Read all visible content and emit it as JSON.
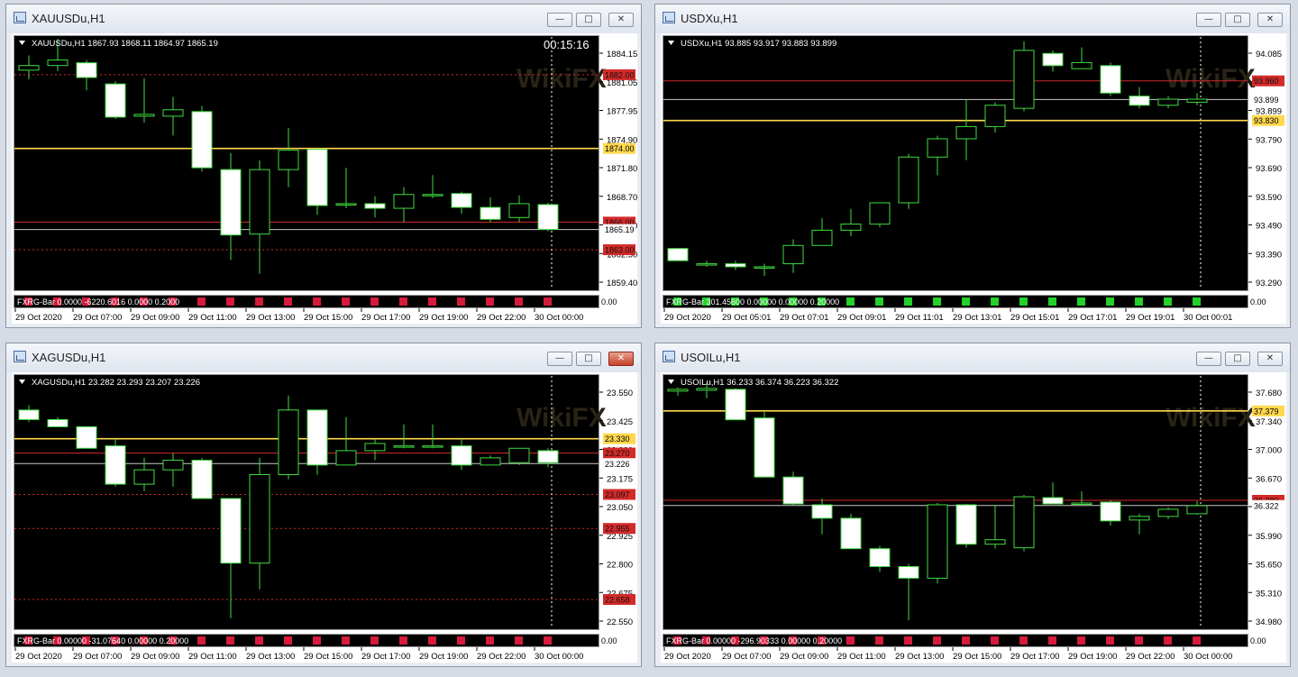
{
  "windows": [
    {
      "title": "XAUUSDu,H1",
      "info": "XAUUSDu,H1  1867.93 1868.11 1864.97 1865.19",
      "timer": "00:15:16",
      "price_labels": [
        "1884.15",
        "1881.05",
        "1877.95",
        "1874.90",
        "1871.80",
        "1868.70",
        "1865.60",
        "1862.50",
        "1859.40"
      ],
      "line_tags": [
        {
          "text": "1882.00",
          "color": "#d42a2a",
          "fg": "#111111"
        },
        {
          "text": "1874.00",
          "color": "#ffd84d",
          "fg": "#000000"
        },
        {
          "text": "1866.00",
          "color": "#d42a2a",
          "fg": "#111111"
        },
        {
          "text": "1865.19",
          "color": "#ffffff",
          "fg": "#000000"
        },
        {
          "text": "1863.00",
          "color": "#d42a2a",
          "fg": "#111111"
        }
      ],
      "indicator": "FXRG-Bar 0.0000 -6220.6016 0.0000 0.2000",
      "indicator_scale": "0.00",
      "time_labels": [
        "29 Oct 2020",
        "29 Oct 07:00",
        "29 Oct 09:00",
        "29 Oct 11:00",
        "29 Oct 13:00",
        "29 Oct 15:00",
        "29 Oct 17:00",
        "29 Oct 19:00",
        "29 Oct 22:00",
        "30 Oct 00:00"
      ],
      "close_active": false
    },
    {
      "title": "USDXu,H1",
      "info": "USDXu,H1  93.885 93.917 93.883 93.899",
      "timer": "",
      "price_labels": [
        "94.085",
        "93.985",
        "93.899",
        "93.790",
        "93.690",
        "93.590",
        "93.490",
        "93.390",
        "93.290"
      ],
      "line_tags": [
        {
          "text": "93.960",
          "color": "#d42a2a",
          "fg": "#111111"
        },
        {
          "text": "93.899",
          "color": "#ffffff",
          "fg": "#000000"
        },
        {
          "text": "93.830",
          "color": "#ffd84d",
          "fg": "#000000"
        }
      ],
      "indicator": "FXRG-Bar 301.45600 0.00000 0.00000 0.20000",
      "indicator_scale": "0.00",
      "time_labels": [
        "29 Oct 2020",
        "29 Oct 05:01",
        "29 Oct 07:01",
        "29 Oct 09:01",
        "29 Oct 11:01",
        "29 Oct 13:01",
        "29 Oct 15:01",
        "29 Oct 17:01",
        "29 Oct 19:01",
        "30 Oct 00:01"
      ],
      "close_active": false
    },
    {
      "title": "XAGUSDu,H1",
      "info": "XAGUSDu,H1  23.282 23.293 23.207 23.226",
      "timer": "",
      "price_labels": [
        "23.550",
        "23.425",
        "23.300",
        "23.175",
        "23.050",
        "22.925",
        "22.800",
        "22.675",
        "22.550"
      ],
      "line_tags": [
        {
          "text": "23.330",
          "color": "#ffd84d",
          "fg": "#000000"
        },
        {
          "text": "23.270",
          "color": "#d42a2a",
          "fg": "#111111"
        },
        {
          "text": "23.226",
          "color": "#ffffff",
          "fg": "#000000"
        },
        {
          "text": "23.097",
          "color": "#d42a2a",
          "fg": "#111111"
        },
        {
          "text": "22.955",
          "color": "#d42a2a",
          "fg": "#111111"
        },
        {
          "text": "22.658",
          "color": "#d42a2a",
          "fg": "#111111"
        }
      ],
      "indicator": "FXRG-Bar 0.00000 -31.07640 0.00000 0.20000",
      "indicator_scale": "0.00",
      "time_labels": [
        "29 Oct 2020",
        "29 Oct 07:00",
        "29 Oct 09:00",
        "29 Oct 11:00",
        "29 Oct 13:00",
        "29 Oct 15:00",
        "29 Oct 17:00",
        "29 Oct 19:00",
        "29 Oct 22:00",
        "30 Oct 00:00"
      ],
      "close_active": true
    },
    {
      "title": "USOILu,H1",
      "info": "USOILu,H1  36.233 36.374 36.223 36.322",
      "timer": "",
      "price_labels": [
        "37.680",
        "37.340",
        "37.000",
        "36.670",
        "36.330",
        "35.990",
        "35.650",
        "35.310",
        "34.980"
      ],
      "line_tags": [
        {
          "text": "37.379",
          "color": "#ffd84d",
          "fg": "#000000"
        },
        {
          "text": "36.380",
          "color": "#d42a2a",
          "fg": "#111111"
        },
        {
          "text": "36.322",
          "color": "#ffffff",
          "fg": "#000000"
        }
      ],
      "indicator": "FXRG-Bar 0.00000 -296.90333 0.00000 0.20000",
      "indicator_scale": "0.00",
      "time_labels": [
        "29 Oct 2020",
        "29 Oct 07:00",
        "29 Oct 09:00",
        "29 Oct 11:00",
        "29 Oct 13:00",
        "29 Oct 15:00",
        "29 Oct 17:00",
        "29 Oct 19:00",
        "29 Oct 22:00",
        "30 Oct 00:00"
      ],
      "close_active": false
    }
  ],
  "watermark": "WikiFX",
  "chart_data": [
    {
      "type": "candlestick",
      "title": "XAUUSDu,H1",
      "ylim": [
        1858.5,
        1886.3
      ],
      "horizontal_lines": [
        {
          "value": 1882.0,
          "style": "dashed",
          "color": "#d42a2a"
        },
        {
          "value": 1874.0,
          "style": "solid",
          "color": "#ffd84d"
        },
        {
          "value": 1866.0,
          "style": "solid",
          "color": "#d42a2a"
        },
        {
          "value": 1865.19,
          "style": "solid",
          "color": "#c8c8c8"
        },
        {
          "value": 1863.0,
          "style": "dashed",
          "color": "#d42a2a"
        }
      ],
      "ohlc": [
        [
          1882.5,
          1884.1,
          1881.5,
          1883.0
        ],
        [
          1883.0,
          1885.9,
          1882.4,
          1883.6
        ],
        [
          1883.3,
          1883.6,
          1880.3,
          1881.7
        ],
        [
          1881.0,
          1881.3,
          1877.2,
          1877.4
        ],
        [
          1877.5,
          1881.6,
          1876.8,
          1877.7
        ],
        [
          1877.5,
          1879.6,
          1875.4,
          1878.2
        ],
        [
          1878.0,
          1878.6,
          1871.5,
          1871.9
        ],
        [
          1871.7,
          1873.5,
          1861.9,
          1864.6
        ],
        [
          1864.7,
          1872.7,
          1860.4,
          1871.7
        ],
        [
          1871.7,
          1876.2,
          1869.8,
          1873.8
        ],
        [
          1873.9,
          1874.0,
          1866.8,
          1867.8
        ],
        [
          1868.0,
          1871.9,
          1867.5,
          1868.0
        ],
        [
          1868.0,
          1868.8,
          1866.5,
          1867.5
        ],
        [
          1867.5,
          1869.8,
          1866.0,
          1869.0
        ],
        [
          1869.0,
          1871.1,
          1868.6,
          1869.0
        ],
        [
          1869.1,
          1869.3,
          1866.9,
          1867.6
        ],
        [
          1867.6,
          1868.7,
          1866.0,
          1866.3
        ],
        [
          1866.5,
          1868.9,
          1866.0,
          1868.0
        ],
        [
          1867.9,
          1868.1,
          1865.0,
          1865.2
        ]
      ],
      "indicator_bars": [
        "red",
        "red",
        "red",
        "red",
        "red",
        "red",
        "red",
        "red",
        "red",
        "red",
        "red",
        "red",
        "red",
        "red",
        "red",
        "red",
        "red",
        "red",
        "red"
      ]
    },
    {
      "type": "candlestick",
      "title": "USDXu,H1",
      "ylim": [
        93.27,
        94.11
      ],
      "horizontal_lines": [
        {
          "value": 93.96,
          "style": "solid",
          "color": "#d42a2a"
        },
        {
          "value": 93.899,
          "style": "solid",
          "color": "#c8c8c8"
        },
        {
          "value": 93.83,
          "style": "solid",
          "color": "#ffd84d"
        }
      ],
      "ohlc": [
        [
          93.41,
          93.41,
          93.37,
          93.37
        ],
        [
          93.36,
          93.37,
          93.35,
          93.36
        ],
        [
          93.36,
          93.37,
          93.34,
          93.35
        ],
        [
          93.35,
          93.36,
          93.32,
          93.35
        ],
        [
          93.36,
          93.44,
          93.33,
          93.42
        ],
        [
          93.42,
          93.51,
          93.42,
          93.47
        ],
        [
          93.47,
          93.54,
          93.45,
          93.49
        ],
        [
          93.49,
          93.56,
          93.48,
          93.56
        ],
        [
          93.56,
          93.72,
          93.54,
          93.71
        ],
        [
          93.71,
          93.78,
          93.65,
          93.77
        ],
        [
          93.77,
          93.9,
          93.7,
          93.81
        ],
        [
          93.81,
          93.89,
          93.79,
          93.88
        ],
        [
          93.87,
          94.09,
          93.86,
          94.06
        ],
        [
          94.05,
          94.06,
          93.99,
          94.01
        ],
        [
          94.0,
          94.07,
          94.0,
          94.02
        ],
        [
          94.01,
          94.02,
          93.91,
          93.92
        ],
        [
          93.91,
          93.94,
          93.87,
          93.88
        ],
        [
          93.88,
          93.91,
          93.87,
          93.9
        ],
        [
          93.89,
          93.92,
          93.88,
          93.9
        ]
      ],
      "indicator_bars": [
        "green",
        "green",
        "green",
        "green",
        "green",
        "green",
        "green",
        "green",
        "green",
        "green",
        "green",
        "green",
        "green",
        "green",
        "green",
        "green",
        "green",
        "green",
        "green"
      ]
    },
    {
      "type": "candlestick",
      "title": "XAGUSDu,H1",
      "ylim": [
        22.53,
        23.6
      ],
      "horizontal_lines": [
        {
          "value": 23.33,
          "style": "solid",
          "color": "#ffd84d"
        },
        {
          "value": 23.27,
          "style": "solid",
          "color": "#d42a2a"
        },
        {
          "value": 23.226,
          "style": "solid",
          "color": "#c8c8c8"
        },
        {
          "value": 23.097,
          "style": "dashed",
          "color": "#d42a2a"
        },
        {
          "value": 22.955,
          "style": "dashed",
          "color": "#d42a2a"
        },
        {
          "value": 22.658,
          "style": "dashed",
          "color": "#d42a2a"
        }
      ],
      "ohlc": [
        [
          23.45,
          23.47,
          23.4,
          23.41
        ],
        [
          23.41,
          23.42,
          23.38,
          23.38
        ],
        [
          23.38,
          23.38,
          23.29,
          23.29
        ],
        [
          23.3,
          23.33,
          23.13,
          23.14
        ],
        [
          23.14,
          23.25,
          23.11,
          23.2
        ],
        [
          23.2,
          23.27,
          23.13,
          23.24
        ],
        [
          23.24,
          23.25,
          23.08,
          23.08
        ],
        [
          23.08,
          23.08,
          22.58,
          22.81
        ],
        [
          22.81,
          23.25,
          22.7,
          23.18
        ],
        [
          23.18,
          23.51,
          23.16,
          23.45
        ],
        [
          23.45,
          23.45,
          23.18,
          23.22
        ],
        [
          23.22,
          23.42,
          23.22,
          23.28
        ],
        [
          23.28,
          23.33,
          23.24,
          23.31
        ],
        [
          23.3,
          23.39,
          23.29,
          23.3
        ],
        [
          23.3,
          23.39,
          23.29,
          23.3
        ],
        [
          23.3,
          23.33,
          23.2,
          23.22
        ],
        [
          23.22,
          23.26,
          23.22,
          23.25
        ],
        [
          23.23,
          23.29,
          23.22,
          23.29
        ],
        [
          23.28,
          23.29,
          23.21,
          23.23
        ]
      ],
      "indicator_bars": [
        "red",
        "red",
        "red",
        "red",
        "red",
        "red",
        "red",
        "red",
        "red",
        "red",
        "red",
        "red",
        "red",
        "red",
        "red",
        "red",
        "red",
        "red",
        "red"
      ]
    },
    {
      "type": "candlestick",
      "title": "USOILu,H1",
      "ylim": [
        34.93,
        37.79
      ],
      "horizontal_lines": [
        {
          "value": 37.379,
          "style": "solid",
          "color": "#ffd84d"
        },
        {
          "value": 36.38,
          "style": "solid",
          "color": "#d42a2a"
        },
        {
          "value": 36.322,
          "style": "solid",
          "color": "#c8c8c8"
        }
      ],
      "ohlc": [
        [
          37.6,
          37.64,
          37.55,
          37.62
        ],
        [
          37.61,
          37.69,
          37.52,
          37.63
        ],
        [
          37.62,
          37.63,
          37.28,
          37.28
        ],
        [
          37.3,
          37.37,
          36.64,
          36.64
        ],
        [
          36.64,
          36.7,
          36.33,
          36.34
        ],
        [
          36.33,
          36.4,
          36.0,
          36.18
        ],
        [
          36.18,
          36.23,
          35.84,
          35.84
        ],
        [
          35.84,
          35.87,
          35.58,
          35.64
        ],
        [
          35.64,
          35.67,
          35.04,
          35.51
        ],
        [
          35.51,
          36.35,
          35.45,
          36.33
        ],
        [
          36.33,
          36.34,
          35.85,
          35.89
        ],
        [
          35.89,
          36.33,
          35.84,
          35.94
        ],
        [
          35.85,
          36.44,
          35.81,
          36.42
        ],
        [
          36.41,
          36.58,
          36.34,
          36.34
        ],
        [
          36.35,
          36.48,
          36.33,
          36.35
        ],
        [
          36.36,
          36.38,
          36.1,
          36.15
        ],
        [
          36.16,
          36.23,
          36.0,
          36.2
        ],
        [
          36.2,
          36.3,
          36.17,
          36.28
        ],
        [
          36.23,
          36.37,
          36.22,
          36.32
        ]
      ],
      "indicator_bars": [
        "red",
        "red",
        "red",
        "red",
        "red",
        "red",
        "red",
        "red",
        "red",
        "red",
        "red",
        "red",
        "red",
        "red",
        "red",
        "red",
        "red",
        "red",
        "red"
      ]
    }
  ]
}
